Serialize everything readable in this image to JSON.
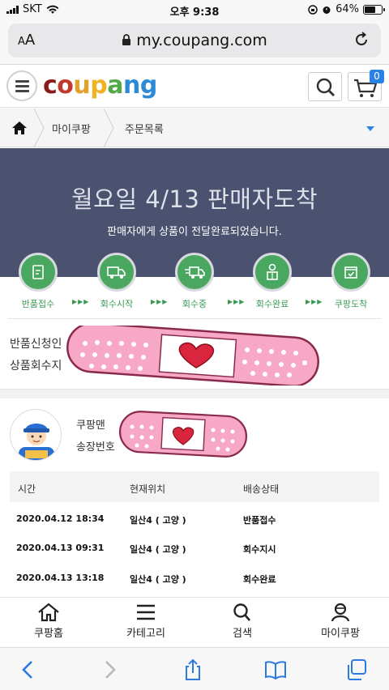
{
  "status_bar": {
    "carrier": "SKT",
    "time": "오후 9:38",
    "battery": "64%",
    "battery_level": 0.64
  },
  "browser": {
    "aa_label": "A",
    "aa_label_big": "A",
    "url": "my.coupang.com"
  },
  "header": {
    "logo": [
      "c",
      "o",
      "u",
      "p",
      "a",
      "n",
      "g"
    ],
    "logo_colors": [
      "#8b1a1a",
      "#c0392b",
      "#e2a12b",
      "#f0b323",
      "#55a84a",
      "#2b8ad8",
      "#2b8ad8"
    ],
    "cart_count": "0"
  },
  "breadcrumb": {
    "items": [
      "마이쿠팡",
      "주문목록"
    ]
  },
  "banner": {
    "title": "월요일 4/13 판매자도착",
    "subtitle": "판매자에게 상품이 전달완료되었습니다."
  },
  "steps": [
    {
      "label": "반품접수",
      "icon": "document-icon"
    },
    {
      "label": "회수시작",
      "icon": "truck-icon"
    },
    {
      "label": "회수중",
      "icon": "moving-truck-icon"
    },
    {
      "label": "회수완료",
      "icon": "person-box-icon"
    },
    {
      "label": "쿠팡도착",
      "icon": "box-check-icon"
    }
  ],
  "step_arrows": "▶▶▶",
  "return_info": {
    "applicant_label": "반품신청인",
    "address_label": "상품회수지"
  },
  "courier": {
    "name_label": "쿠팡맨",
    "invoice_label": "송장번호"
  },
  "table": {
    "headers": [
      "시간",
      "현재위치",
      "배송상태"
    ],
    "rows": [
      {
        "time": "2020.04.12 18:34",
        "location": "일산4 ( 고양 )",
        "status": "반품접수"
      },
      {
        "time": "2020.04.13 09:31",
        "location": "일산4 ( 고양 )",
        "status": "회수지시"
      },
      {
        "time": "2020.04.13 13:18",
        "location": "일산4 ( 고양 )",
        "status": "회수완료"
      }
    ]
  },
  "tabbar": [
    {
      "label": "쿠팡홈",
      "icon": "home-icon"
    },
    {
      "label": "카테고리",
      "icon": "menu-icon"
    },
    {
      "label": "검색",
      "icon": "search-icon"
    },
    {
      "label": "마이쿠팡",
      "icon": "user-icon"
    }
  ],
  "colors": {
    "accent_blue": "#2a82e4",
    "banner": "#4b5270",
    "step_green": "#4aa760",
    "bandaid_pink": "#f4a6c4",
    "heart_red": "#d9263e"
  }
}
